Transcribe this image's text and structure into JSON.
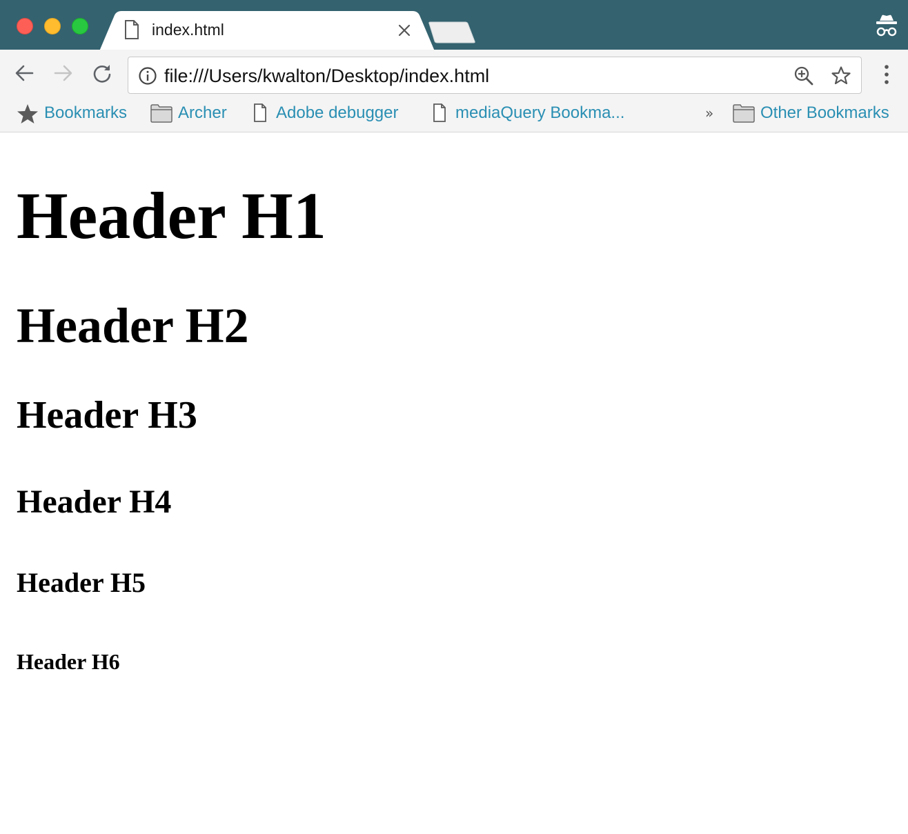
{
  "window": {
    "controls": [
      "close",
      "minimize",
      "maximize"
    ],
    "colors": {
      "titlebar": "#34626f",
      "tab_active": "#ffffff",
      "link": "#2a8fb3"
    }
  },
  "tabs": [
    {
      "title": "index.html",
      "icon": "page-icon",
      "active": true
    }
  ],
  "toolbar": {
    "url": "file:///Users/kwalton/Desktop/index.html",
    "icons": [
      "back-arrow-icon",
      "forward-arrow-icon",
      "reload-icon",
      "info-icon",
      "zoom-icon",
      "star-icon",
      "menu-dots-icon"
    ]
  },
  "bookmarks": {
    "items": [
      {
        "label": "Bookmarks",
        "icon": "star-icon"
      },
      {
        "label": "Archer",
        "icon": "folder-icon"
      },
      {
        "label": "Adobe debugger",
        "icon": "page-icon"
      },
      {
        "label": "mediaQuery Bookma...",
        "icon": "page-icon"
      }
    ],
    "overflow": "»",
    "other": {
      "label": "Other Bookmarks",
      "icon": "folder-icon"
    }
  },
  "content": {
    "headings": [
      {
        "level": 1,
        "text": "Header H1"
      },
      {
        "level": 2,
        "text": "Header H2"
      },
      {
        "level": 3,
        "text": "Header H3"
      },
      {
        "level": 4,
        "text": "Header H4"
      },
      {
        "level": 5,
        "text": "Header H5"
      },
      {
        "level": 6,
        "text": "Header H6"
      }
    ]
  }
}
